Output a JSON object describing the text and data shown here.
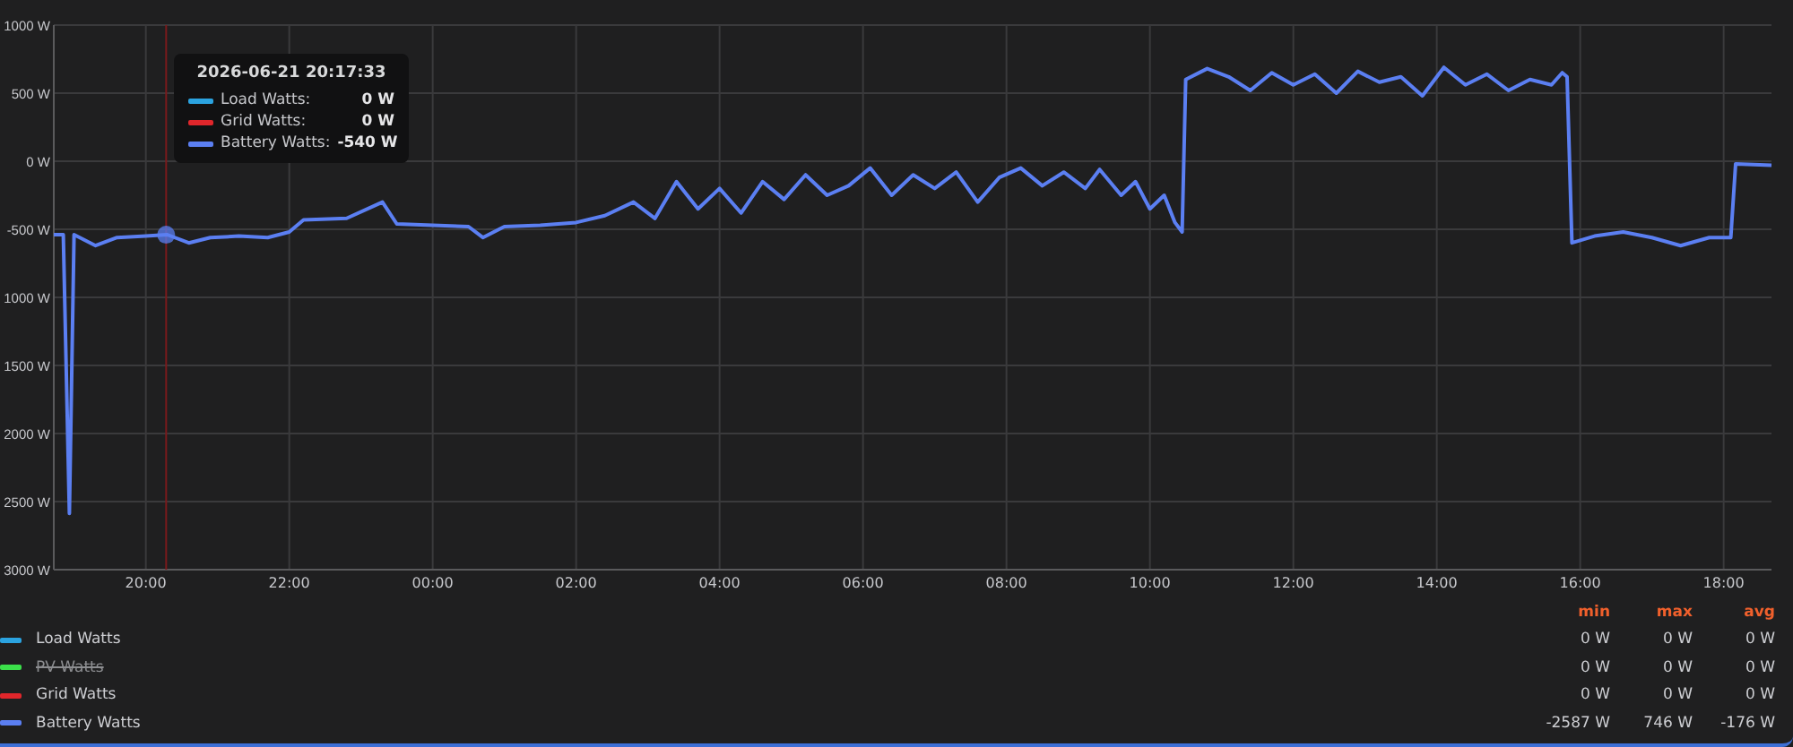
{
  "chart_data": {
    "type": "line",
    "x": [
      "2026-06-21T18:43",
      "2026-06-21T18:51",
      "2026-06-21T18:56",
      "2026-06-21T19:00",
      "2026-06-21T19:18",
      "2026-06-21T19:36",
      "2026-06-21T20:00",
      "2026-06-21T20:18",
      "2026-06-21T20:36",
      "2026-06-21T20:54",
      "2026-06-21T21:18",
      "2026-06-21T21:42",
      "2026-06-21T22:00",
      "2026-06-21T22:12",
      "2026-06-21T22:48",
      "2026-06-21T23:18",
      "2026-06-21T23:30",
      "2026-06-22T00:00",
      "2026-06-22T00:30",
      "2026-06-22T00:42",
      "2026-06-22T01:00",
      "2026-06-22T01:30",
      "2026-06-22T02:00",
      "2026-06-22T02:24",
      "2026-06-22T02:48",
      "2026-06-22T03:06",
      "2026-06-22T03:24",
      "2026-06-22T03:42",
      "2026-06-22T04:00",
      "2026-06-22T04:18",
      "2026-06-22T04:36",
      "2026-06-22T04:54",
      "2026-06-22T05:12",
      "2026-06-22T05:30",
      "2026-06-22T05:48",
      "2026-06-22T06:06",
      "2026-06-22T06:24",
      "2026-06-22T06:42",
      "2026-06-22T07:00",
      "2026-06-22T07:18",
      "2026-06-22T07:36",
      "2026-06-22T07:54",
      "2026-06-22T08:12",
      "2026-06-22T08:30",
      "2026-06-22T08:48",
      "2026-06-22T09:06",
      "2026-06-22T09:18",
      "2026-06-22T09:36",
      "2026-06-22T09:48",
      "2026-06-22T10:00",
      "2026-06-22T10:12",
      "2026-06-22T10:21",
      "2026-06-22T10:27",
      "2026-06-22T10:30",
      "2026-06-22T10:48",
      "2026-06-22T11:06",
      "2026-06-22T11:24",
      "2026-06-22T11:42",
      "2026-06-22T12:00",
      "2026-06-22T12:18",
      "2026-06-22T12:36",
      "2026-06-22T12:54",
      "2026-06-22T13:12",
      "2026-06-22T13:30",
      "2026-06-22T13:48",
      "2026-06-22T14:06",
      "2026-06-22T14:24",
      "2026-06-22T14:42",
      "2026-06-22T15:00",
      "2026-06-22T15:18",
      "2026-06-22T15:36",
      "2026-06-22T15:45",
      "2026-06-22T15:49",
      "2026-06-22T15:53",
      "2026-06-22T16:12",
      "2026-06-22T16:36",
      "2026-06-22T17:00",
      "2026-06-22T17:24",
      "2026-06-22T17:48",
      "2026-06-22T18:06",
      "2026-06-22T18:10",
      "2026-06-22T18:40"
    ],
    "series": [
      {
        "name": "Battery Watts",
        "color": "#5b7ff2",
        "values": [
          -540,
          -540,
          -2587,
          -540,
          -620,
          -560,
          -550,
          -540,
          -600,
          -560,
          -550,
          -560,
          -520,
          -430,
          -420,
          -300,
          -460,
          -470,
          -480,
          -560,
          -480,
          -470,
          -450,
          -400,
          -300,
          -420,
          -150,
          -350,
          -200,
          -380,
          -150,
          -280,
          -100,
          -250,
          -180,
          -50,
          -250,
          -100,
          -200,
          -80,
          -300,
          -120,
          -50,
          -180,
          -80,
          -200,
          -60,
          -250,
          -150,
          -350,
          -250,
          -450,
          -520,
          600,
          680,
          620,
          520,
          650,
          560,
          640,
          500,
          660,
          580,
          620,
          480,
          690,
          560,
          640,
          520,
          600,
          560,
          650,
          620,
          -600,
          -550,
          -520,
          -560,
          -620,
          -560,
          -560,
          -20,
          -30
        ]
      }
    ],
    "xlim": [
      "2026-06-21T18:43",
      "2026-06-22T18:40"
    ],
    "ylim": [
      -3000,
      1000
    ],
    "xticks": [
      {
        "value": "2026-06-21T20:00",
        "label": "20:00"
      },
      {
        "value": "2026-06-21T22:00",
        "label": "22:00"
      },
      {
        "value": "2026-06-22T00:00",
        "label": "00:00"
      },
      {
        "value": "2026-06-22T02:00",
        "label": "02:00"
      },
      {
        "value": "2026-06-22T04:00",
        "label": "04:00"
      },
      {
        "value": "2026-06-22T06:00",
        "label": "06:00"
      },
      {
        "value": "2026-06-22T08:00",
        "label": "08:00"
      },
      {
        "value": "2026-06-22T10:00",
        "label": "10:00"
      },
      {
        "value": "2026-06-22T12:00",
        "label": "12:00"
      },
      {
        "value": "2026-06-22T14:00",
        "label": "14:00"
      },
      {
        "value": "2026-06-22T16:00",
        "label": "16:00"
      },
      {
        "value": "2026-06-22T18:00",
        "label": "18:00"
      }
    ],
    "grid": true,
    "ref_lines": [
      {
        "axis": "x",
        "value": "2026-06-21T20:17"
      }
    ],
    "yticks": [
      {
        "value": 1000,
        "label": "1000 W"
      },
      {
        "value": 500,
        "label": "500 W"
      },
      {
        "value": 0,
        "label": "0 W"
      },
      {
        "value": -500,
        "label": "-500 W"
      },
      {
        "value": -1000,
        "label": "1000 W"
      },
      {
        "value": -1500,
        "label": "1500 W"
      },
      {
        "value": -2000,
        "label": "2000 W"
      },
      {
        "value": -2500,
        "label": "2500 W"
      },
      {
        "value": -3000,
        "label": "3000 W"
      }
    ]
  },
  "tooltip": {
    "title": "2026-06-21 20:17:33",
    "rows": [
      {
        "name": "Load Watts:",
        "value": "0 W",
        "color": "#2ba3e0"
      },
      {
        "name": "Grid Watts:",
        "value": "0 W",
        "color": "#e0262b"
      },
      {
        "name": "Battery Watts:",
        "value": "-540 W",
        "color": "#5b7ff2"
      }
    ]
  },
  "legend": {
    "columns": [
      "min",
      "max",
      "avg"
    ],
    "rows": [
      {
        "name": "Load Watts",
        "color": "#2ba3e0",
        "hidden": false,
        "min": "0 W",
        "max": "0 W",
        "avg": "0 W"
      },
      {
        "name": "PV Watts",
        "color": "#3be04a",
        "hidden": true,
        "min": "0 W",
        "max": "0 W",
        "avg": "0 W"
      },
      {
        "name": "Grid Watts",
        "color": "#e0262b",
        "hidden": false,
        "min": "0 W",
        "max": "0 W",
        "avg": "0 W"
      },
      {
        "kind": "charted",
        "color": "#5b7ff2",
        "hidden": false,
        "min": "-2587 W",
        "max": "746 W",
        "avg": "-176 W"
      }
    ]
  }
}
